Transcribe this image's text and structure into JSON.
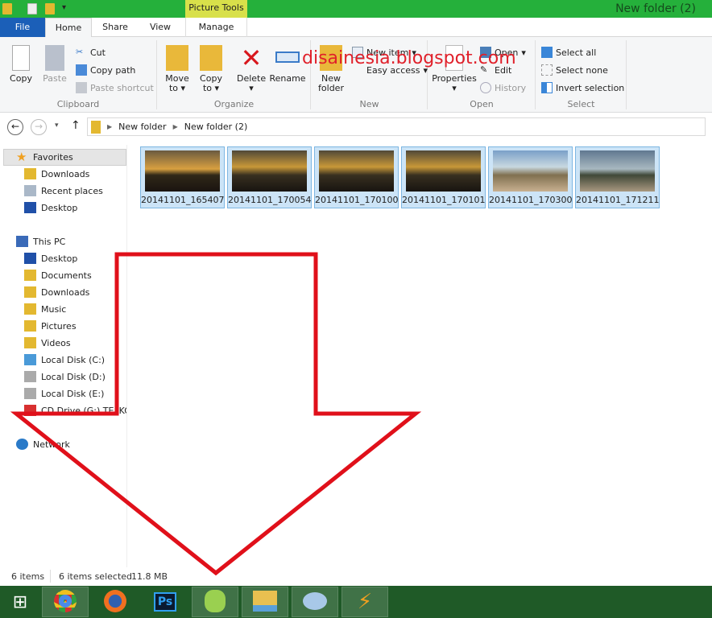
{
  "window": {
    "title": "New folder (2)",
    "context_tab_group": "Picture Tools"
  },
  "tabs": [
    {
      "label": "File"
    },
    {
      "label": "Home"
    },
    {
      "label": "Share"
    },
    {
      "label": "View"
    },
    {
      "label": "Manage"
    }
  ],
  "ribbon": {
    "clipboard": {
      "label": "Clipboard",
      "copy": "Copy",
      "paste": "Paste",
      "cut": "Cut",
      "copy_path": "Copy path",
      "paste_shortcut": "Paste shortcut"
    },
    "organize": {
      "label": "Organize",
      "move_to": "Move to",
      "copy_to": "Copy to",
      "delete": "Delete",
      "rename": "Rename"
    },
    "new": {
      "label": "New",
      "new_folder": "New folder",
      "new_item": "New item",
      "easy_access": "Easy access"
    },
    "open": {
      "label": "Open",
      "properties": "Properties",
      "open": "Open",
      "edit": "Edit",
      "history": "History"
    },
    "select": {
      "label": "Select",
      "select_all": "Select all",
      "select_none": "Select none",
      "invert": "Invert selection"
    }
  },
  "watermark": "disainesia.blogspot.com",
  "address": {
    "crumbs": [
      "New folder",
      "New folder (2)"
    ]
  },
  "nav": {
    "favorites": "Favorites",
    "favorites_items": [
      "Downloads",
      "Recent places",
      "Desktop"
    ],
    "this_pc": "This PC",
    "pc_items": [
      "Desktop",
      "Documents",
      "Downloads",
      "Music",
      "Pictures",
      "Videos",
      "Local Disk (C:)",
      "Local Disk (D:)",
      "Local Disk (E:)",
      "CD Drive (G:) TELKO"
    ],
    "network": "Network"
  },
  "files": [
    "20141101_165407",
    "20141101_170054",
    "20141101_170100",
    "20141101_170101",
    "20141101_170300",
    "20141101_171211"
  ],
  "status": {
    "items": "6 items",
    "selected": "6 items selected",
    "size": "11.8 MB"
  },
  "taskbar": [
    "windows-start",
    "chrome",
    "firefox",
    "photoshop",
    "coreldraw",
    "file-explorer",
    "paint",
    "winamp"
  ],
  "colors": {
    "titlebar": "#25b03b",
    "taskbar": "#1f5a27",
    "selection": "#cce4f7",
    "arrow": "#e0101a"
  }
}
